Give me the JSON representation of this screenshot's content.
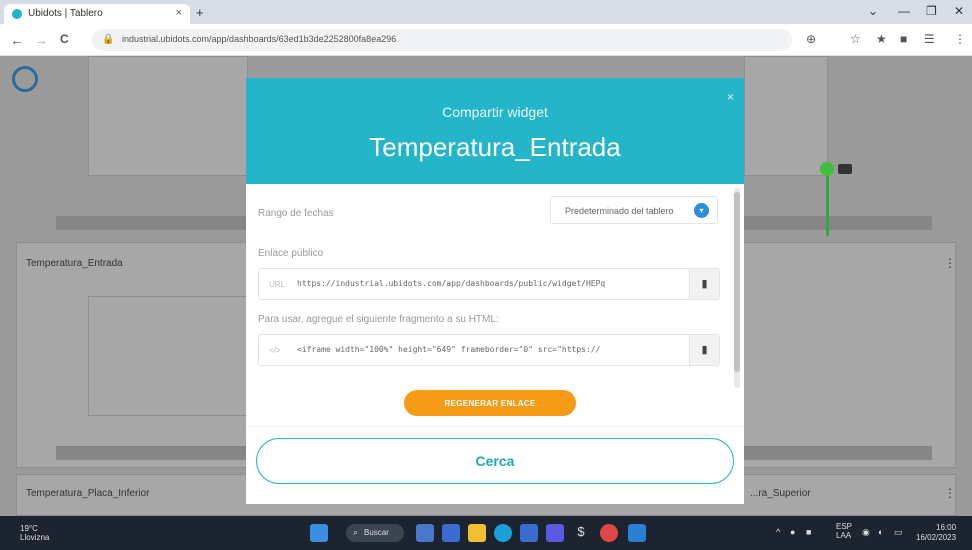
{
  "browser": {
    "tab_title": "Ubidots | Tablero",
    "tab_close": "×",
    "new_tab": "+",
    "url": "industrial.ubidots.com/app/dashboards/63ed1b3de2252800fa8ea296",
    "window_controls": [
      "⌄",
      "—",
      "❐",
      "✕"
    ],
    "nav_back": "←",
    "nav_forward": "→",
    "nav_reload": "C",
    "extensions": [
      "⊕",
      "☆",
      "★",
      "■",
      "☰",
      "⋮"
    ]
  },
  "dashboard": {
    "panels": [
      {
        "title": "Temperatura_Entrada"
      },
      {
        "title": "Temperatura_Placa_Inferior"
      },
      {
        "title": "...ra_Superior"
      }
    ],
    "kebab": "⋮"
  },
  "modal": {
    "subtitle": "Compartir widget",
    "title": "Temperatura_Entrada",
    "close_icon": "×",
    "date_range_label": "Rango de fechas",
    "date_range_value": "Predeterminado del tablero",
    "public_link_label": "Enlace público",
    "public_link_prefix": "URL",
    "public_link_value": "https://industrial.ubidots.com/app/dashboards/public/widget/HEPq",
    "embed_label": "Para usar, agregue el siguiente fragmento a su HTML:",
    "embed_prefix": "</>",
    "embed_value": "<iframe width=\"100%\" height=\"649\" frameborder=\"0\" src=\"https://",
    "regenerate_label": "REGENERAR ENLACE",
    "close_label": "Cerca"
  },
  "taskbar": {
    "weather_temp": "19°C",
    "weather_desc": "Llovizna",
    "search_label": "Buscar",
    "lang": "ESP",
    "lang_sub": "LAA",
    "time": "16:00",
    "date": "16/02/2023"
  }
}
